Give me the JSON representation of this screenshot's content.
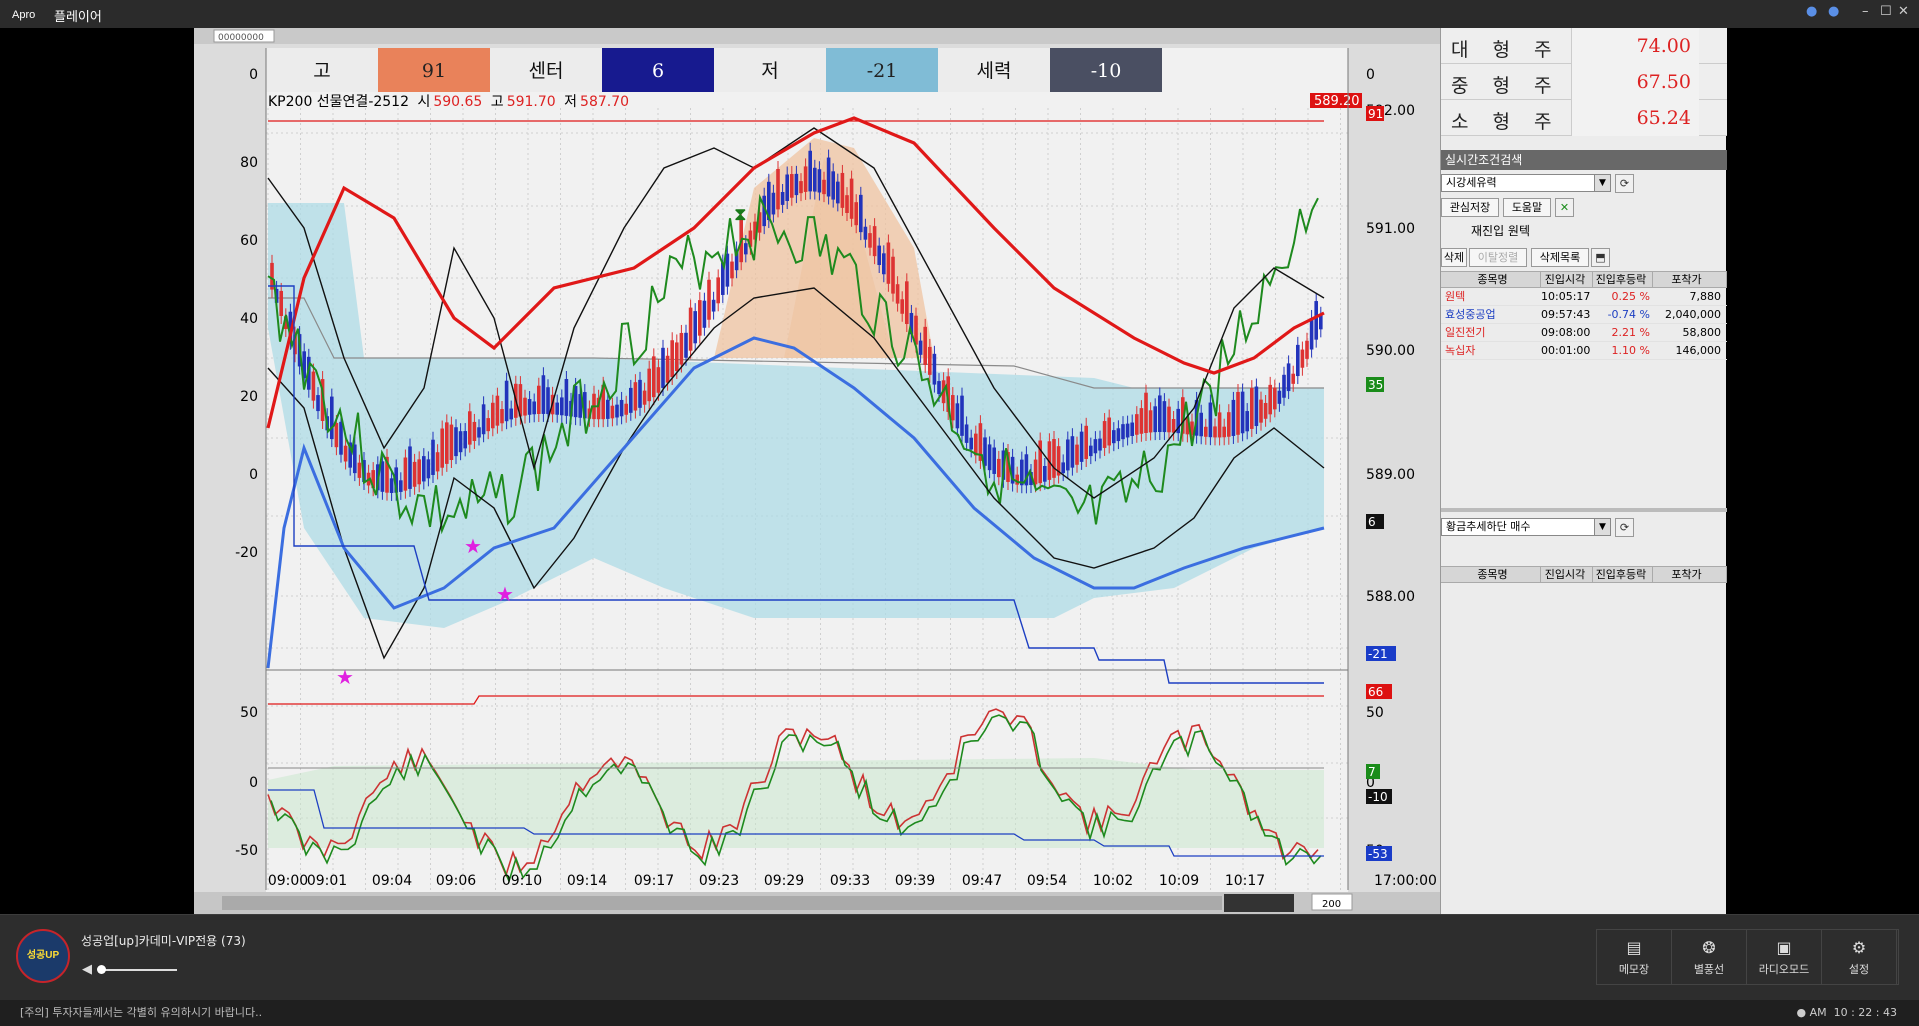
{
  "app": {
    "logo": "Apro",
    "title": "플레이어",
    "win_min": "–",
    "win_max": "☐",
    "win_close": "✕"
  },
  "chart": {
    "indicator_row": [
      {
        "label": "고",
        "value": "91",
        "color": "#e9825a"
      },
      {
        "label": "센터",
        "value": "6",
        "color": "#171a8f"
      },
      {
        "label": "저",
        "value": "-21",
        "color": "#80bcd6"
      },
      {
        "label": "세력",
        "value": "-10",
        "color": "#4a4f62"
      }
    ],
    "header": {
      "name": "KP200 선물연결-2512",
      "o_label": "시",
      "o": "590.65",
      "h_label": "고",
      "h": "591.70",
      "l_label": "저",
      "l": "587.70",
      "last": "589.20"
    },
    "left_axis_main": [
      "0",
      "80",
      "60",
      "40",
      "20",
      "0",
      "-20"
    ],
    "right_axis_main": [
      "0",
      "592.00",
      "591.00",
      "590.00",
      "589.00",
      "588.00"
    ],
    "left_axis_sub": [
      "50",
      "0",
      "-50"
    ],
    "right_axis_sub": [
      "50",
      "0",
      "50"
    ],
    "badges_main": [
      {
        "text": "91",
        "bg": "#d11"
      },
      {
        "text": "35",
        "bg": "#1a8c1a"
      },
      {
        "text": "6",
        "bg": "#111"
      },
      {
        "text": "-21",
        "bg": "#1a3cc8"
      }
    ],
    "badges_sub": [
      {
        "text": "66",
        "bg": "#d11"
      },
      {
        "text": "7",
        "bg": "#1a8c1a"
      },
      {
        "text": "-10",
        "bg": "#111"
      },
      {
        "text": "-53",
        "bg": "#1a3cc8"
      }
    ],
    "time_labels": [
      "09:00",
      "09:01",
      "09:04",
      "09:06",
      "09:10",
      "09:14",
      "09:17",
      "09:23",
      "09:29",
      "09:33",
      "09:39",
      "09:47",
      "09:54",
      "10:02",
      "10:09",
      "10:17"
    ],
    "end_time": "17:00:00",
    "zoom_value": "200",
    "toolbar_field": "00000000"
  },
  "right_panel": {
    "sizes": [
      {
        "name": "대형주",
        "value": "74.00"
      },
      {
        "name": "중형주",
        "value": "67.50"
      },
      {
        "name": "소형주",
        "value": "65.24"
      }
    ],
    "cond_title": "실시간조건검색",
    "cond_select": "시강세유력",
    "btn_save": "관심저장",
    "btn_help": "도움말",
    "reentry": "재진입 원텍",
    "btn_delete": "삭제",
    "btn_sort": "이탈정렬",
    "btn_dellist": "삭제목록",
    "columns": [
      "종목명",
      "진입시각",
      "진입후등락",
      "포착가"
    ],
    "rows": [
      {
        "name": "원텍",
        "time": "10:05:17",
        "change": "0.25 %",
        "price": "7,880",
        "color": "#d22"
      },
      {
        "name": "효성중공업",
        "time": "09:57:43",
        "change": "-0.74 %",
        "price": "2,040,000",
        "color": "#1d3fc2"
      },
      {
        "name": "일진전기",
        "time": "09:08:00",
        "change": "2.21 %",
        "price": "58,800",
        "color": "#d22"
      },
      {
        "name": "녹십자",
        "time": "00:01:00",
        "change": "1.10 %",
        "price": "146,000",
        "color": "#d22"
      }
    ],
    "cond_select2": "황금추세하단 매수",
    "columns2": [
      "종목명",
      "진입시각",
      "진입후등락",
      "포착가"
    ]
  },
  "bottom": {
    "channel": "성공업[up]카데미-VIP전용 (73)",
    "avatar_text": "성공UP",
    "tools": [
      {
        "icon": "▤",
        "label": "메모장"
      },
      {
        "icon": "❂",
        "label": "별풍선"
      },
      {
        "icon": "▣",
        "label": "라디오모드"
      },
      {
        "icon": "⚙",
        "label": "설정"
      }
    ]
  },
  "status": {
    "notice": "[주의] 투자자들께서는 각별히 유의하시기 바랍니다..",
    "ampm": "AM",
    "time": "10 : 22 : 43"
  }
}
